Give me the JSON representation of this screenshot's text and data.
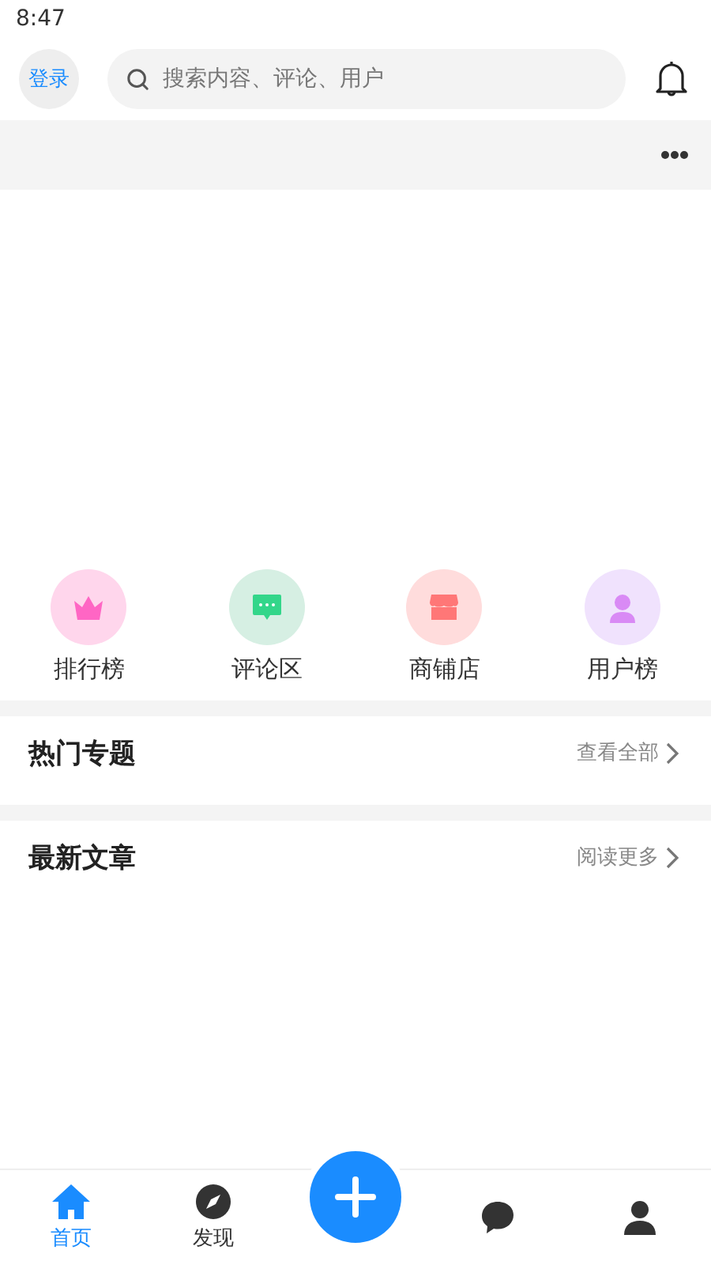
{
  "status_bar": {
    "time": "8:47"
  },
  "header": {
    "login": "登录",
    "search": {
      "placeholder": "搜索内容、评论、用户"
    }
  },
  "shortcuts": [
    {
      "label": "排行榜",
      "kind": "crown",
      "color": "#ff66c4"
    },
    {
      "label": "评论区",
      "kind": "comment",
      "color": "#33d68a"
    },
    {
      "label": "商铺店",
      "kind": "shop",
      "color": "#ff7777"
    },
    {
      "label": "用户榜",
      "kind": "user",
      "color": "#d98af5"
    }
  ],
  "sections": [
    {
      "title": "热门专题",
      "link": "查看全部"
    },
    {
      "title": "最新文章",
      "link": "阅读更多"
    }
  ],
  "tab_bar": [
    {
      "kind": "home",
      "label": "首页",
      "selected": true
    },
    {
      "kind": "compass",
      "label": "发现",
      "selected": false
    },
    {
      "kind": "add",
      "selected": false
    },
    {
      "kind": "message",
      "selected": false
    },
    {
      "kind": "user",
      "selected": false
    }
  ]
}
